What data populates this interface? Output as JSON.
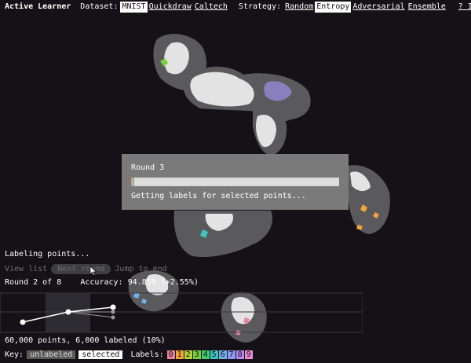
{
  "app": {
    "title": "Active Learner"
  },
  "nav": {
    "dataset_label": "Dataset:",
    "datasets": [
      "MNIST",
      "Quickdraw",
      "Caltech"
    ],
    "selected_dataset": "MNIST",
    "strategy_label": "Strategy:",
    "strategies": [
      "Random",
      "Entropy",
      "Adversarial",
      "Ensemble"
    ],
    "selected_strategy": "Entropy",
    "info_label": "? Info"
  },
  "modal": {
    "title": "Round 3",
    "progress": 0.015,
    "message": "Getting labels for selected points..."
  },
  "panel": {
    "status": "Labeling points...",
    "view_list": "View list",
    "next_round": "Next round",
    "jump_to_end": "Jump to end",
    "round_text": "Round 2 of 8",
    "accuracy_text": "Accuracy: 94.85% (+2.55%)",
    "count_text": "60,000 points, 6,000 labeled (10%)"
  },
  "key": {
    "label": "Key:",
    "unlabeled": "unlabeled",
    "selected": "selected",
    "labels_label": "Labels:",
    "labels": [
      "0",
      "1",
      "2",
      "3",
      "4",
      "5",
      "6",
      "7",
      "8",
      "9"
    ],
    "label_colors": [
      "#e8839c",
      "#f4a33b",
      "#b6d33c",
      "#79cf3e",
      "#41c96e",
      "#3ec4c0",
      "#6fb1ec",
      "#8f9bf2",
      "#b48af0",
      "#ef8ad2"
    ]
  },
  "colors": {
    "background": "#151217",
    "cluster": "#5a5a5c",
    "labeled": "#e3e3e3"
  }
}
